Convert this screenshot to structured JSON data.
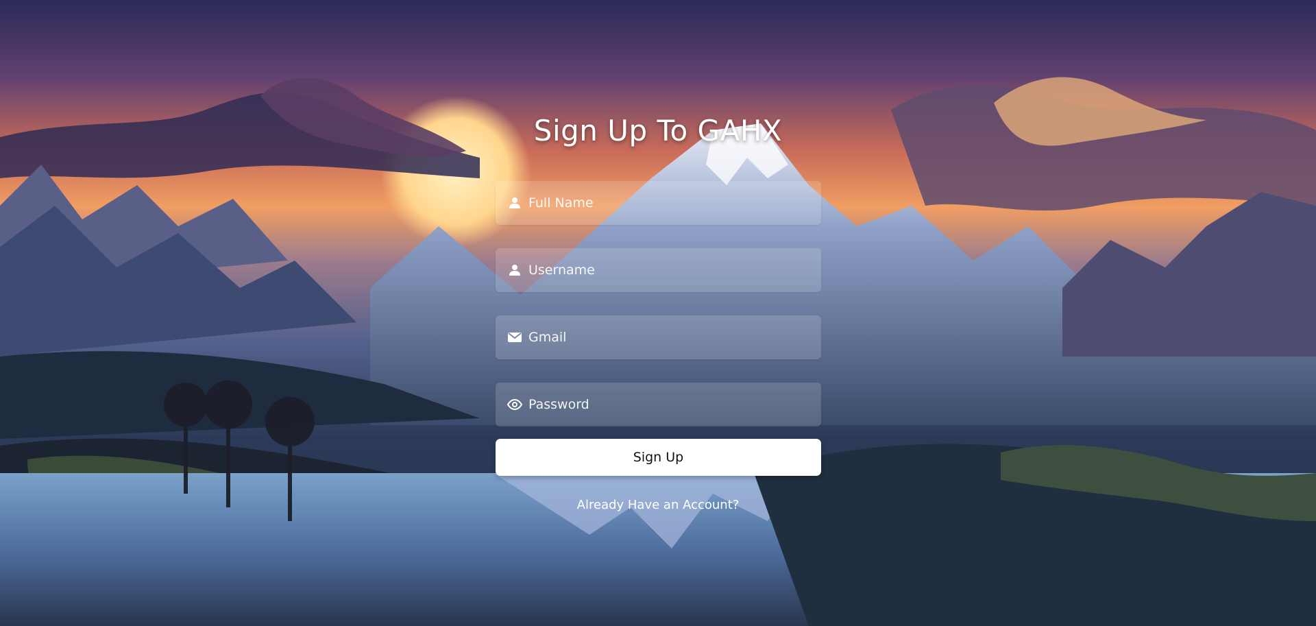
{
  "page": {
    "title": "Sign Up To GAHX"
  },
  "form": {
    "fields": [
      {
        "placeholder": "Full Name",
        "icon": "user-icon"
      },
      {
        "placeholder": "Username",
        "icon": "user-icon"
      },
      {
        "placeholder": "Gmail",
        "icon": "mail-icon"
      },
      {
        "placeholder": "Password",
        "icon": "eye-icon"
      }
    ],
    "submit_label": "Sign Up",
    "login_link": "Already Have an Account?"
  },
  "colors": {
    "text": "#ffffff",
    "button_bg": "#ffffff",
    "button_text": "#111111",
    "field_bg": "rgba(255,255,255,0.16)"
  }
}
